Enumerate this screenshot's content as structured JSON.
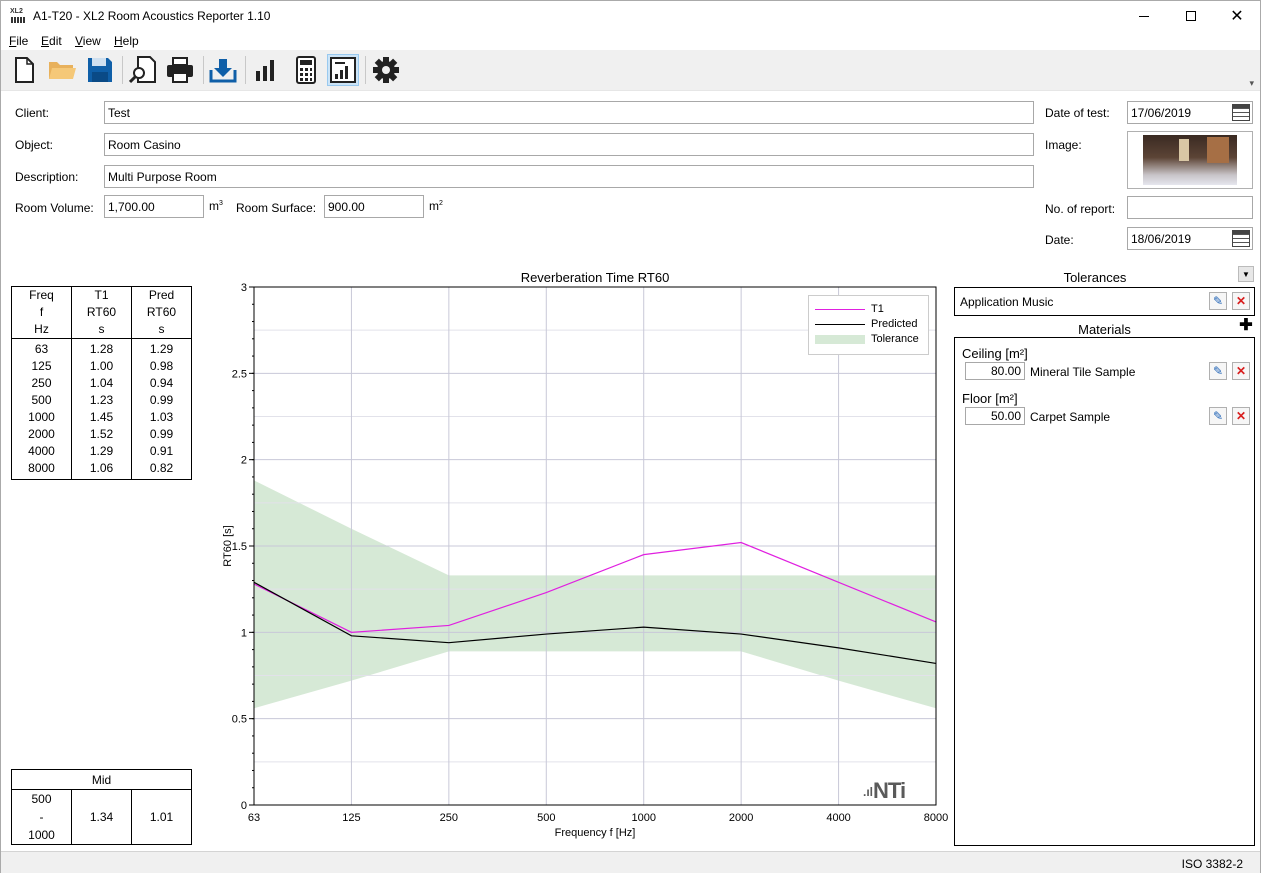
{
  "window": {
    "app_icon_text": "XL2",
    "title": "A1-T20 - XL2 Room Acoustics Reporter 1.10"
  },
  "menu": {
    "items": [
      {
        "label": "File",
        "mnemonic": "F",
        "rest": "ile"
      },
      {
        "label": "Edit",
        "mnemonic": "E",
        "rest": "dit"
      },
      {
        "label": "View",
        "mnemonic": "V",
        "rest": "iew"
      },
      {
        "label": "Help",
        "mnemonic": "H",
        "rest": "elp"
      }
    ]
  },
  "toolbar": {
    "buttons": [
      {
        "name": "new-file-icon"
      },
      {
        "name": "open-folder-icon"
      },
      {
        "name": "save-icon"
      },
      {
        "name": "print-preview-icon"
      },
      {
        "name": "print-icon"
      },
      {
        "name": "download-icon"
      },
      {
        "name": "bar-chart-icon"
      },
      {
        "name": "calculator-icon"
      },
      {
        "name": "report-chart-icon",
        "active": true
      },
      {
        "name": "settings-icon"
      }
    ],
    "accent": "#0f5fa8",
    "folder_color": "#e8b15c"
  },
  "form": {
    "client_label": "Client:",
    "client": "Test",
    "object_label": "Object:",
    "object": "Room Casino",
    "description_label": "Description:",
    "description": "Multi Purpose Room",
    "room_volume_label": "Room Volume:",
    "room_volume": "1,700.00",
    "room_volume_unit": "m",
    "room_surface_label": "Room Surface:",
    "room_surface": "900.00",
    "room_surface_unit": "m",
    "date_of_test_label": "Date of test:",
    "date_of_test": "17/06/2019",
    "image_label": "Image:",
    "no_of_report_label": "No. of report:",
    "no_of_report": "",
    "date_label": "Date:",
    "date": "18/06/2019"
  },
  "freq_table": {
    "headers": [
      [
        "Freq",
        "f",
        "Hz"
      ],
      [
        "T1",
        "RT60",
        "s"
      ],
      [
        "Pred",
        "RT60",
        "s"
      ]
    ],
    "rows": [
      [
        "63",
        "1.28",
        "1.29"
      ],
      [
        "125",
        "1.00",
        "0.98"
      ],
      [
        "250",
        "1.04",
        "0.94"
      ],
      [
        "500",
        "1.23",
        "0.99"
      ],
      [
        "1000",
        "1.45",
        "1.03"
      ],
      [
        "2000",
        "1.52",
        "0.99"
      ],
      [
        "4000",
        "1.29",
        "0.91"
      ],
      [
        "8000",
        "1.06",
        "0.82"
      ]
    ]
  },
  "mid_table": {
    "header": "Mid",
    "range_from": "500",
    "range_sep": "-",
    "range_to": "1000",
    "t1": "1.34",
    "pred": "1.01"
  },
  "chart_data": {
    "type": "line",
    "title": "Reverberation Time RT60",
    "xlabel": "Frequency f [Hz]",
    "ylabel": "RT60 [s]",
    "categories": [
      "63",
      "125",
      "250",
      "500",
      "1000",
      "2000",
      "4000",
      "8000"
    ],
    "ylim": [
      0,
      3
    ],
    "yticks": [
      "0",
      "0.5",
      "1",
      "1.5",
      "2",
      "2.5",
      "3"
    ],
    "grid": true,
    "legend_position": "top-right",
    "series": [
      {
        "name": "T1",
        "color": "#e020e0",
        "values": [
          1.28,
          1.0,
          1.04,
          1.23,
          1.45,
          1.52,
          1.29,
          1.06
        ]
      },
      {
        "name": "Predicted",
        "color": "#000000",
        "values": [
          1.29,
          0.98,
          0.94,
          0.99,
          1.03,
          0.99,
          0.91,
          0.82
        ]
      }
    ],
    "tolerance": {
      "name": "Tolerance",
      "color": "#d6e9d6",
      "upper": [
        1.88,
        1.6,
        1.33,
        1.33,
        1.33,
        1.33,
        1.33,
        1.33
      ],
      "lower": [
        0.56,
        0.72,
        0.89,
        0.89,
        0.89,
        0.89,
        0.72,
        0.56
      ]
    }
  },
  "logo": {
    "text": "NTi",
    "prefix": ".ıl"
  },
  "tolerances": {
    "heading": "Tolerances",
    "items": [
      {
        "label": "Application Music"
      }
    ]
  },
  "materials": {
    "heading": "Materials",
    "groups": [
      {
        "title": "Ceiling [m²]",
        "area": "80.00",
        "name": "Mineral Tile Sample"
      },
      {
        "title": "Floor [m²]",
        "area": "50.00",
        "name": "Carpet Sample"
      }
    ]
  },
  "status": {
    "text": "ISO 3382-2"
  }
}
